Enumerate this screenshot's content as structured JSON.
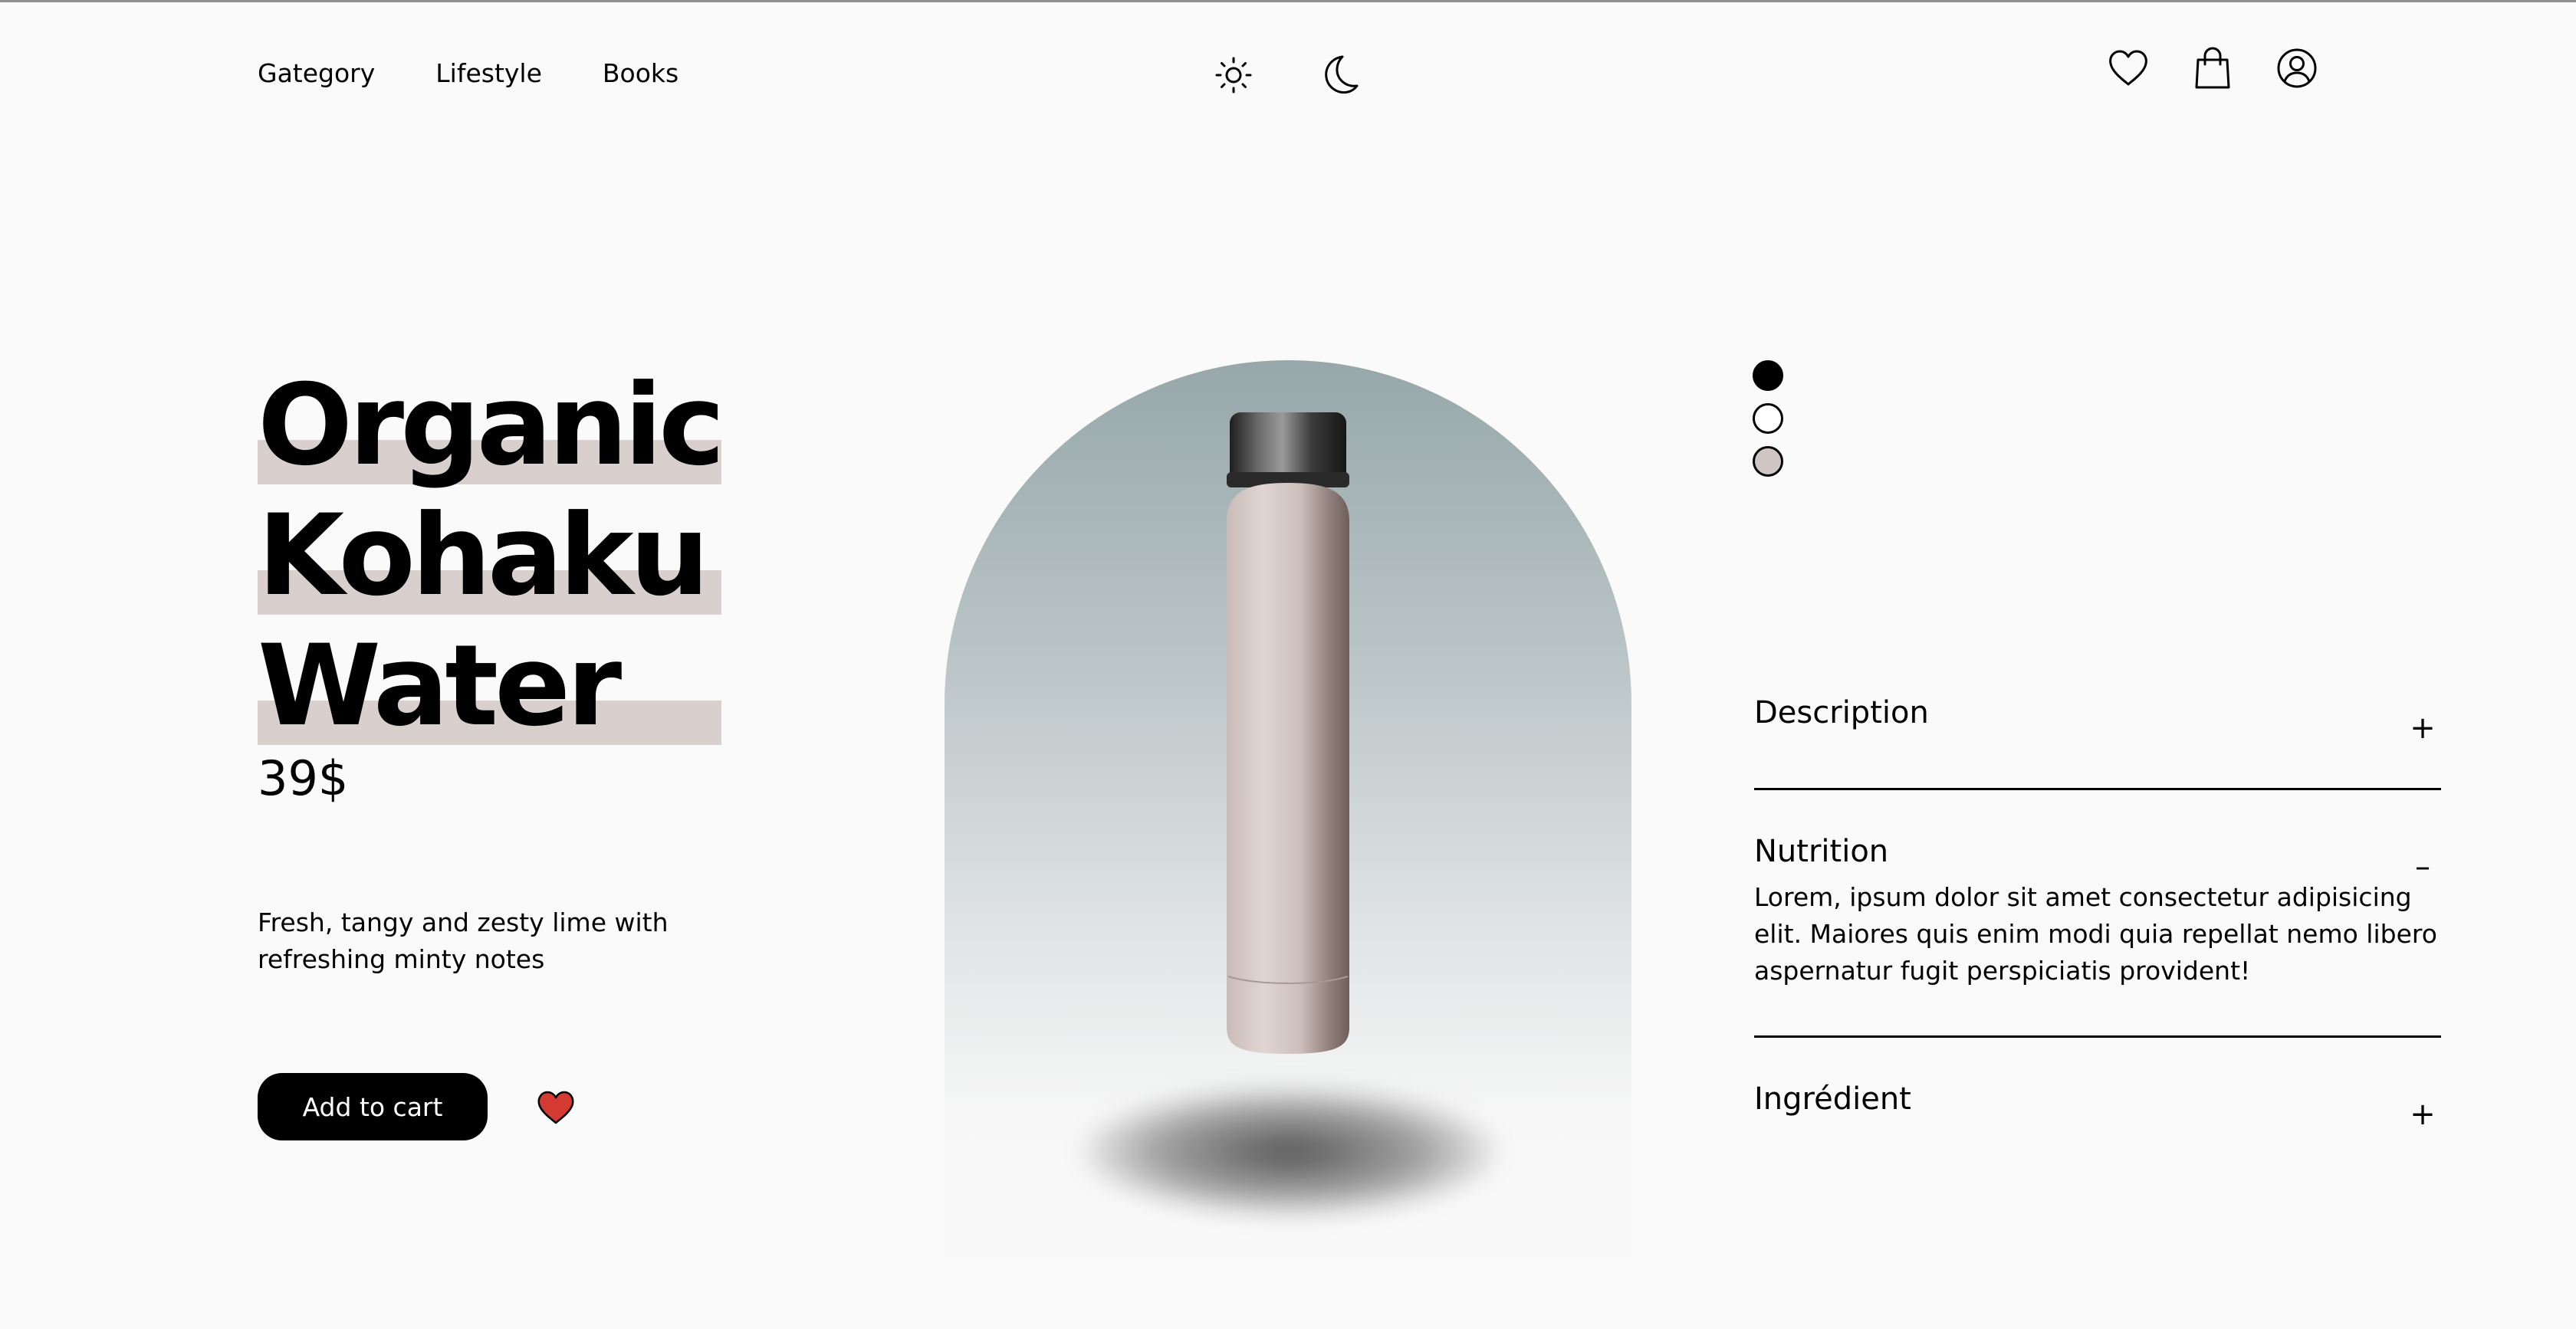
{
  "nav": {
    "links": [
      "Gategory",
      "Lifestyle",
      "Books"
    ],
    "theme_icons": [
      "sun-icon",
      "moon-icon"
    ],
    "action_icons": [
      "heart-icon",
      "shopping-bag-icon",
      "user-icon"
    ]
  },
  "product": {
    "title_lines": [
      "Organic",
      "Kohaku",
      "Water"
    ],
    "price": "39$",
    "tagline": "Fresh, tangy and zesty lime with refreshing minty notes",
    "add_to_cart_label": "Add to cart",
    "favorite_icon": "heart-filled-icon",
    "colors": [
      {
        "name": "black",
        "hex": "#000000",
        "selected": true
      },
      {
        "name": "white",
        "hex": "#ffffff",
        "selected": false
      },
      {
        "name": "taupe",
        "hex": "#cfc6c4",
        "selected": false
      }
    ]
  },
  "accordion": {
    "items": [
      {
        "title": "Description",
        "toggle": "+",
        "expanded": false,
        "body": ""
      },
      {
        "title": "Nutrition",
        "toggle": "–",
        "expanded": true,
        "body": "Lorem, ipsum dolor sit amet consectetur adipisicing elit. Maiores quis enim modi quia repellat nemo libero aspernatur fugit perspiciatis provident!"
      },
      {
        "title": "Ingrédient",
        "toggle": "+",
        "expanded": false,
        "body": ""
      }
    ]
  },
  "colors": {
    "background": "#fafafa",
    "highlight": "#d9d0cd",
    "heart_red": "#d33a32",
    "text": "#000000"
  }
}
